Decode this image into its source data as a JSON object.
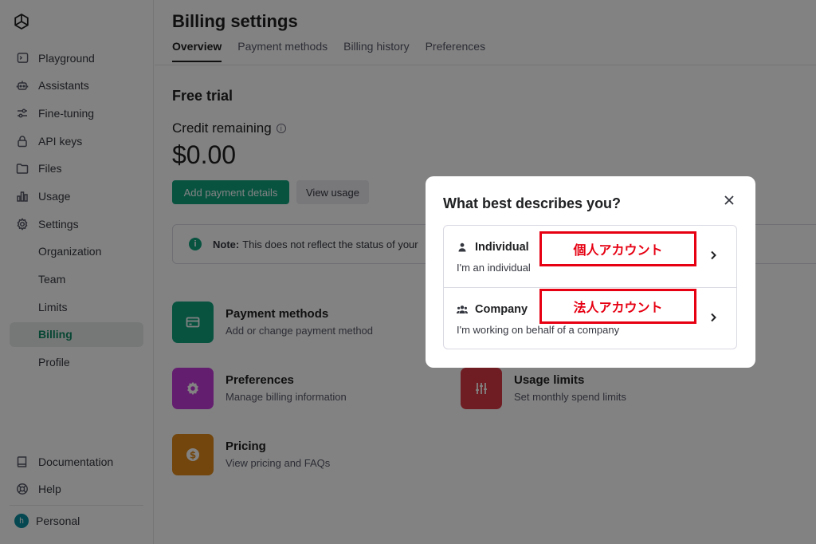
{
  "sidebar": {
    "nav": [
      {
        "label": "Playground",
        "icon": "terminal-icon"
      },
      {
        "label": "Assistants",
        "icon": "robot-icon"
      },
      {
        "label": "Fine-tuning",
        "icon": "sliders-icon"
      },
      {
        "label": "API keys",
        "icon": "lock-icon"
      },
      {
        "label": "Files",
        "icon": "folder-icon"
      },
      {
        "label": "Usage",
        "icon": "bar-chart-icon"
      },
      {
        "label": "Settings",
        "icon": "gear-icon"
      },
      {
        "label": "Organization"
      },
      {
        "label": "Team"
      },
      {
        "label": "Limits"
      },
      {
        "label": "Billing",
        "active": true
      },
      {
        "label": "Profile"
      }
    ],
    "bottom": [
      {
        "label": "Documentation",
        "icon": "book-icon"
      },
      {
        "label": "Help",
        "icon": "lifebuoy-icon"
      }
    ],
    "account": {
      "initial": "h",
      "label": "Personal"
    }
  },
  "main": {
    "title": "Billing settings",
    "tabs": [
      "Overview",
      "Payment methods",
      "Billing history",
      "Preferences"
    ],
    "active_tab": "Overview",
    "plan": "Free trial",
    "credit_label": "Credit remaining",
    "credit_amount": "$0.00",
    "add_payment_label": "Add payment details",
    "view_usage_label": "View usage",
    "note_bold": "Note:",
    "note_text": "This does not reflect the status of your",
    "cards": [
      {
        "title": "Payment methods",
        "subtitle": "Add or change payment method",
        "color": "#10a37f",
        "icon": "credit-card-icon"
      },
      {
        "title": "Preferences",
        "subtitle": "Manage billing information",
        "color": "#c43bd9",
        "icon": "gear-icon"
      },
      {
        "title": "Usage limits",
        "subtitle": "Set monthly spend limits",
        "color": "#d93a45",
        "icon": "sliders-icon"
      },
      {
        "title": "Pricing",
        "subtitle": "View pricing and FAQs",
        "color": "#e08a1a",
        "icon": "dollar-icon"
      }
    ]
  },
  "modal": {
    "title": "What best describes you?",
    "options": [
      {
        "title": "Individual",
        "subtitle": "I'm an individual",
        "icon": "person-icon",
        "annotation": "個人アカウント"
      },
      {
        "title": "Company",
        "subtitle": "I'm working on behalf of a company",
        "icon": "group-icon",
        "annotation": "法人アカウント"
      }
    ]
  },
  "colors": {
    "accent": "#10a37f",
    "annotation_red": "#e60012"
  }
}
